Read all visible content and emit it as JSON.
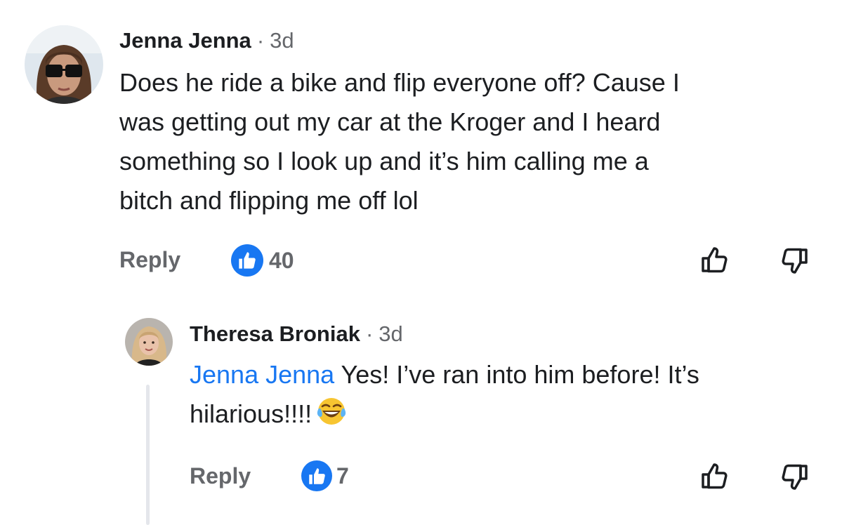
{
  "comments": [
    {
      "author": "Jenna Jenna",
      "separator": "·",
      "time": "3d",
      "lines": [
        "Does he ride a bike and flip everyone off? Cause I",
        "was getting out my car at the Kroger and I heard",
        "something so I look up and it’s him calling me a",
        "bitch and flipping me off lol"
      ],
      "reply_label": "Reply",
      "reaction_count": "40",
      "reaction_icon": "thumbs-up-icon",
      "avatar_icon": "profile-photo-sunglasses"
    }
  ],
  "replies": [
    {
      "author": "Theresa Broniak",
      "separator": "·",
      "time": "3d",
      "mention": "Jenna Jenna",
      "text_line1": " Yes! I’ve ran into him before! It’s",
      "text_line2": "hilarious!!!!",
      "emoji": "laughing-tears-emoji",
      "reply_label": "Reply",
      "reaction_count": "7",
      "reaction_icon": "thumbs-up-icon",
      "avatar_icon": "profile-photo-blonde"
    }
  ],
  "colors": {
    "accent": "#1877f2",
    "secondary_text": "#65676b",
    "primary_text": "#1c1e21",
    "thread_line": "#e4e6eb"
  }
}
